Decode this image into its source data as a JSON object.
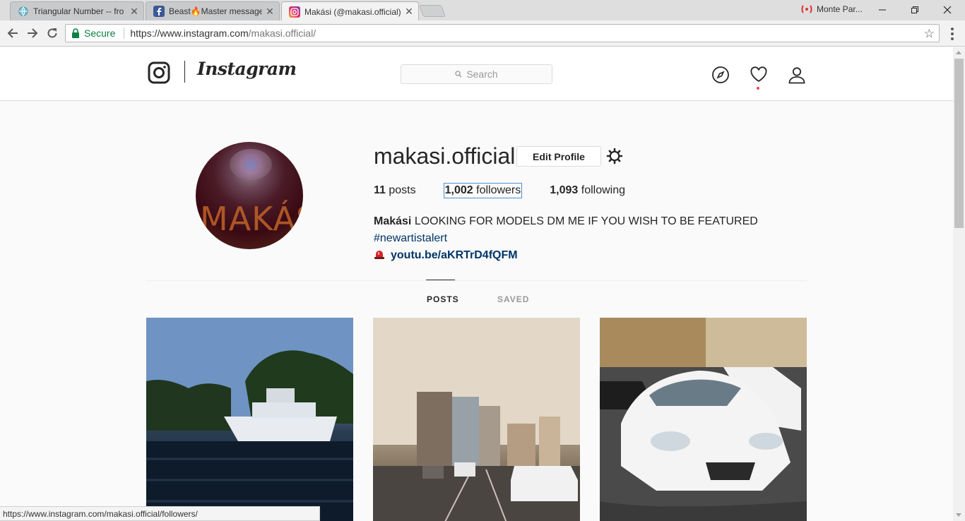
{
  "browser": {
    "tabs": [
      {
        "title": "Triangular Number -- fro",
        "active": false
      },
      {
        "title": "Beast🔥Master message",
        "active": false
      },
      {
        "title": "Makási (@makasi.official)",
        "active": true
      }
    ],
    "profile_name": "Monte Par...",
    "address": {
      "secure_label": "Secure",
      "url_host": "https://www.instagram.com",
      "url_path": "/makasi.official/"
    },
    "status_url": "https://www.instagram.com/makasi.official/followers/"
  },
  "instagram": {
    "wordmark": "Instagram",
    "search_placeholder": "Search",
    "profile": {
      "username": "makasi.official",
      "edit_label": "Edit Profile",
      "stats": {
        "posts_count": "11",
        "posts_label": "posts",
        "followers_count": "1,002",
        "followers_label": "followers",
        "following_count": "1,093",
        "following_label": "following"
      },
      "bio": {
        "name": "Makási",
        "text": "LOOKING FOR MODELS DM ME IF YOU WISH TO BE FEATURED",
        "hashtag": "#newartistalert",
        "link": "youtu.be/aKRTrD4fQFM"
      },
      "avatar_text": "MAKÁSI"
    },
    "tabs": {
      "posts": "POSTS",
      "saved": "SAVED"
    },
    "posts": [
      {
        "subject": "boat on water at dusk"
      },
      {
        "subject": "city skyline from highway"
      },
      {
        "subject": "white sports car parked"
      }
    ]
  },
  "colors": {
    "secure_green": "#0b8043",
    "link_blue": "#003569",
    "notification_red": "#ed4956",
    "focus_outline": "#4a90d9"
  }
}
